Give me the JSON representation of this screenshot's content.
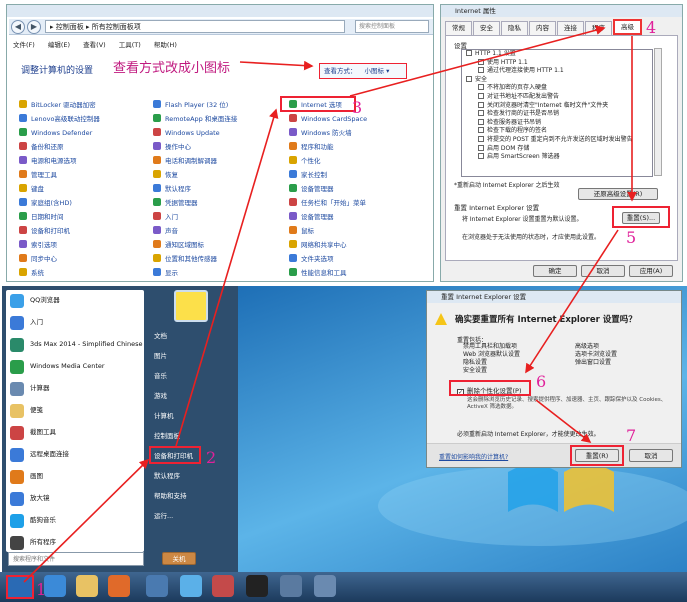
{
  "control_panel": {
    "address": "▸ 控制面板 ▸ 所有控制面板项",
    "search_placeholder": "搜索控制面板",
    "menu": [
      "文件(F)",
      "编辑(E)",
      "查看(V)",
      "工具(T)",
      "帮助(H)"
    ],
    "title": "调整计算机的设置",
    "view_by": "查看方式：",
    "view_mode": "小图标 ▾",
    "note": "查看方式改成小图标",
    "col1": [
      "BitLocker 驱动器加密",
      "Lenovo高级联动控制器",
      "Windows Defender",
      "备份和还原",
      "电源和电源选项",
      "管理工具",
      "键盘",
      "家庭组(含HD)",
      "日期和时间",
      "设备和打印机",
      "索引选项",
      "同步中心",
      "系统"
    ],
    "col2": [
      "Flash Player (32 位)",
      "RemoteApp 和桌面连接",
      "Windows Update",
      "操作中心",
      "电话和调制解调器",
      "恢复",
      "默认程序",
      "凭据管理器",
      "入门",
      "声音",
      "通知区域图标",
      "位置和其他传感器",
      "显示"
    ],
    "col3": [
      "Internet 选项",
      "Windows CardSpace",
      "Windows 防火墙",
      "程序和功能",
      "个性化",
      "家长控制",
      "设备管理器",
      "任务栏和「开始」菜单",
      "设备管理器",
      "鼠标",
      "网络和共享中心",
      "文件夹选项",
      "性能信息和工具"
    ]
  },
  "ie_props": {
    "title": "Internet 属性",
    "tabs": [
      "常规",
      "安全",
      "隐私",
      "内容",
      "连接",
      "程序",
      "高级"
    ],
    "settings_label": "设置",
    "list": [
      "HTTP 1.1 设置",
      "使用 HTTP 1.1",
      "通过代理连接使用 HTTP 1.1",
      "安全",
      "不将加密的页存入硬盘",
      "对证书地址不匹配发出警告",
      "关闭浏览器时清空\"Internet 临时文件\"文件夹",
      "检查发行商的证书是否吊销",
      "检查服务器证书吊销",
      "检查下载的程序的签名",
      "将提交的 POST 重定向到不允许发送的区域时发出警告",
      "启用 DOM 存储",
      "启用 SmartScreen 筛选器"
    ],
    "footer_note": "*重新启动 Internet Explorer 之后生效",
    "restore_btn": "还原高级设置(R)",
    "reset_title": "重置 Internet Explorer 设置",
    "reset_desc": "将 Internet Explorer 设置重置为默认设置。",
    "reset_btn": "重置(S)...",
    "reset_warn": "在浏览器处于无法使用的状态时，才应使用此设置。",
    "ok": "确定",
    "cancel": "取消",
    "apply": "应用(A)"
  },
  "reset_dialog": {
    "title": "重置 Internet Explorer 设置",
    "question": "确实要重置所有 Internet Explorer 设置吗？",
    "reset_includes": "重置包括：",
    "left_items": [
      "禁用工具栏和加载项",
      "Web 浏览器默认设置",
      "隐私设置",
      "安全设置"
    ],
    "right_items": [
      "高级选项",
      "选项卡浏览设置",
      "弹出窗口设置"
    ],
    "checkbox": "删除个性化设置(P)",
    "checkbox_desc": "这会删除浏览历史记录、搜索提供程序、加速器、主页、跟踪保护以及 Cookies、ActiveX 筛选数据。",
    "restart_note": "必须重新启动 Internet Explorer，才能使更改生效。",
    "link": "重置如何影响我的计算机?",
    "reset_btn": "重置(R)",
    "cancel_btn": "取消"
  },
  "start_menu": {
    "left": [
      "QQ浏览器",
      "入门",
      "3ds Max 2014 - Simplified Chinese",
      "Windows Media Center",
      "计算器",
      "便笺",
      "截图工具",
      "远程桌面连接",
      "画图",
      "放大镜",
      "酷狗音乐",
      "所有程序"
    ],
    "search_placeholder": "搜索程序和文件",
    "right": [
      "文档",
      "图片",
      "音乐",
      "游戏",
      "计算机",
      "控制面板",
      "设备和打印机",
      "默认程序",
      "帮助和支持",
      "运行..."
    ],
    "shutdown": "关机"
  },
  "steps": [
    "1",
    "2",
    "3",
    "4",
    "5",
    "6",
    "7"
  ],
  "colors": {
    "annotation": "#e0209a",
    "arrow": "#e82020",
    "link": "#1e4aa0"
  }
}
